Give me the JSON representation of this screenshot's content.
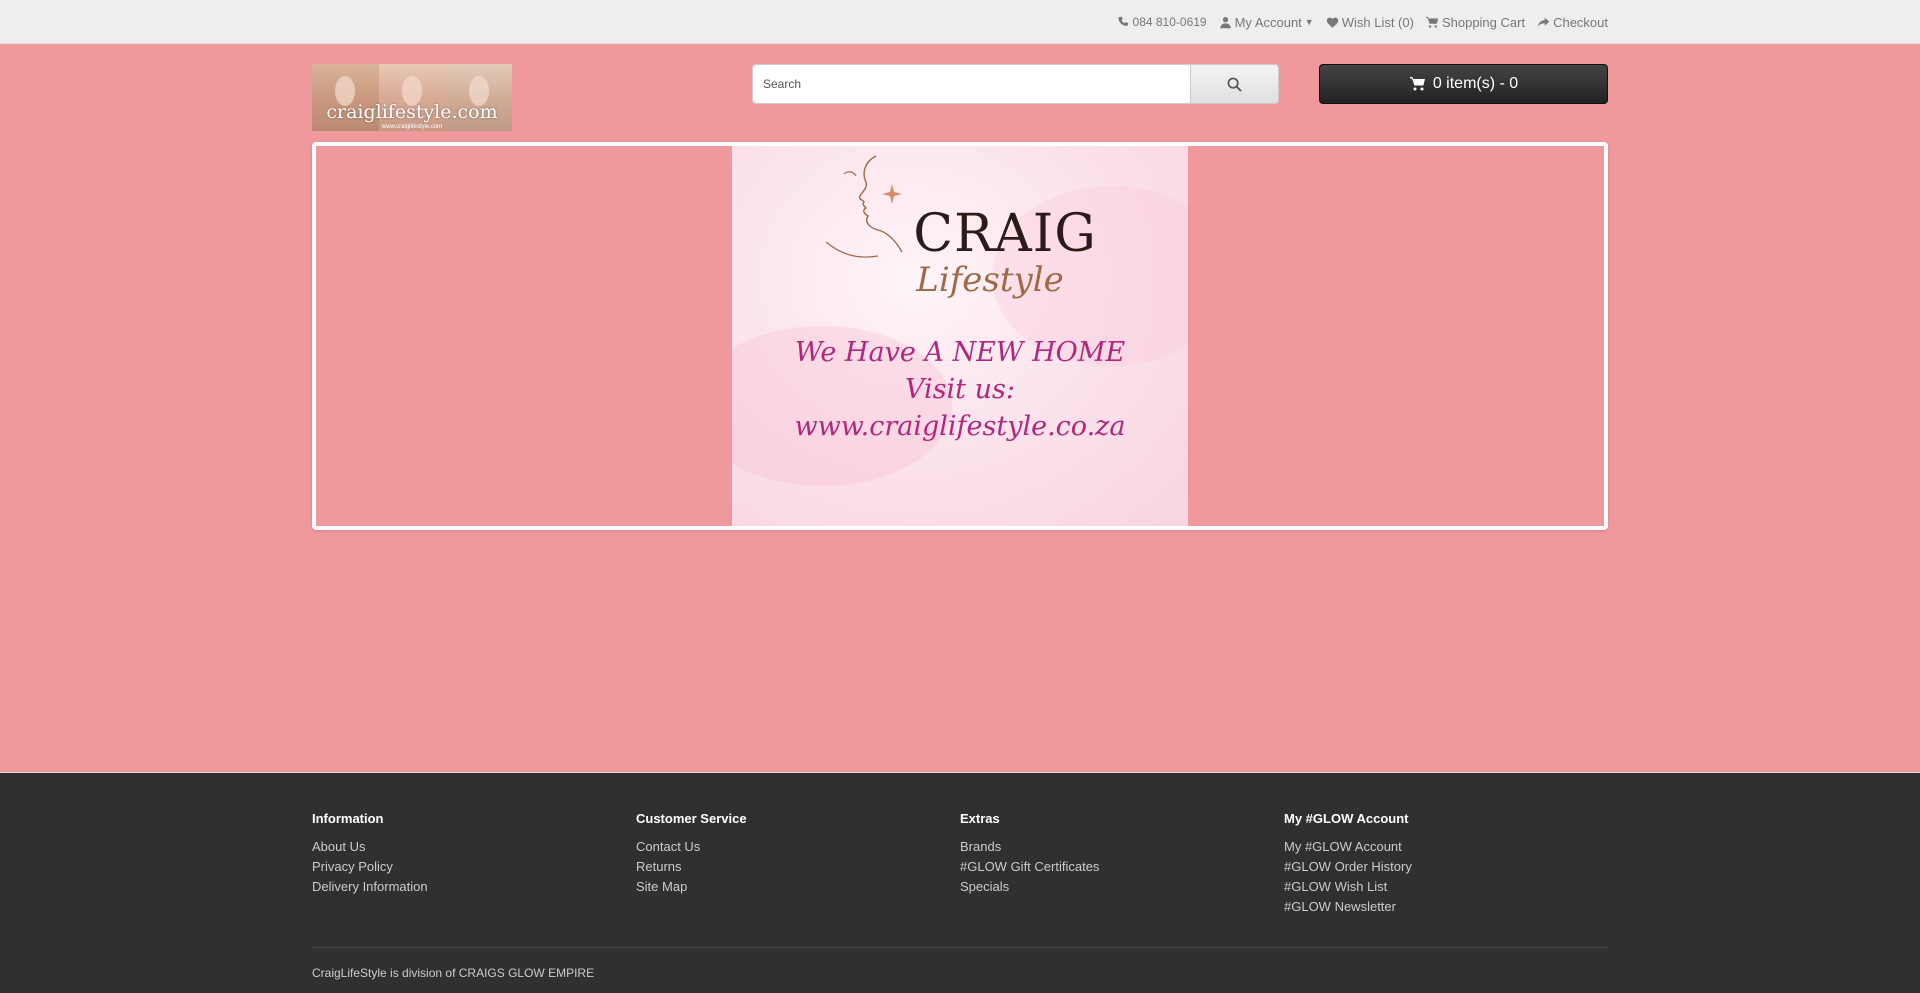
{
  "topbar": {
    "phone": "084 810-0619",
    "my_account": "My Account",
    "wish_list": "Wish List (0)",
    "shopping_cart": "Shopping Cart",
    "checkout": "Checkout"
  },
  "header": {
    "logo_text": "craiglifestyle.com",
    "logo_subtext": "www.craiglifestyle.com",
    "search_placeholder": "Search",
    "cart_label": "0 item(s) - 0"
  },
  "banner": {
    "brand_name": "CRAIG",
    "brand_tagline": "Lifestyle",
    "announcement_lines": [
      "We Have A NEW HOME",
      "Visit us:",
      "www.craiglifestyle.co.za"
    ]
  },
  "footer": {
    "columns": [
      {
        "heading": "Information",
        "links": [
          "About Us",
          "Privacy Policy",
          "Delivery Information"
        ]
      },
      {
        "heading": "Customer Service",
        "links": [
          "Contact Us",
          "Returns",
          "Site Map"
        ]
      },
      {
        "heading": "Extras",
        "links": [
          "Brands",
          "#GLOW Gift Certificates",
          "Specials"
        ]
      },
      {
        "heading": "My #GLOW Account",
        "links": [
          "My #GLOW Account",
          "#GLOW Order History",
          "#GLOW Wish List",
          "#GLOW Newsletter"
        ]
      }
    ],
    "powered": "CraigLifeStyle is division of CRAIGS GLOW EMPIRE"
  },
  "colors": {
    "page_background": "#f0999c",
    "footer_background": "#303030",
    "topbar_background": "#eeeeee",
    "cart_button": "#2b2b2b",
    "announcement_text": "#b0287e"
  }
}
